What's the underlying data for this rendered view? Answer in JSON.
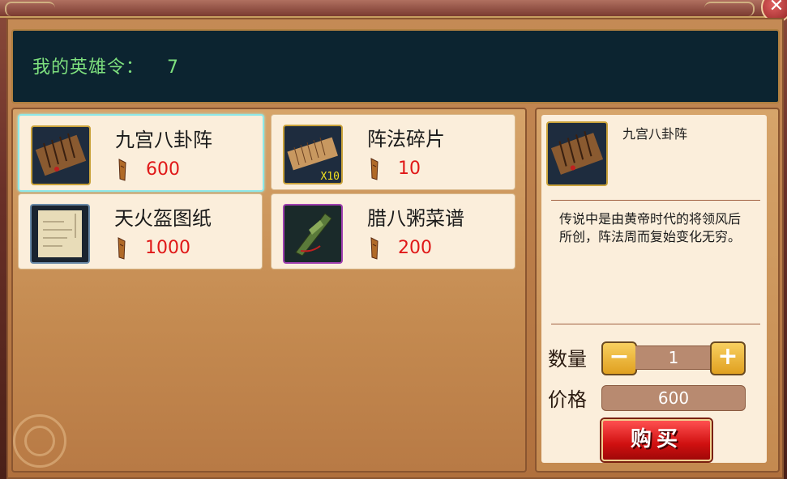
{
  "header": {
    "hero_token_label": "我的英雄令：",
    "hero_token_value": "7"
  },
  "items": [
    {
      "name": "九宫八卦阵",
      "price": "600",
      "qty_badge": ""
    },
    {
      "name": "阵法碎片",
      "price": "10",
      "qty_badge": "X10"
    },
    {
      "name": "天火盔图纸",
      "price": "1000",
      "qty_badge": ""
    },
    {
      "name": "腊八粥菜谱",
      "price": "200",
      "qty_badge": ""
    }
  ],
  "detail": {
    "name": "九宫八卦阵",
    "description": "传说中是由黄帝时代的将领风后所创，阵法周而复始变化无穷。",
    "quantity_label": "数量",
    "quantity_value": "1",
    "price_label": "价格",
    "price_value": "600",
    "buy_label": "购买",
    "minus_symbol": "−",
    "plus_symbol": "+"
  },
  "close_symbol": "✕",
  "colors": {
    "header_text": "#7ee07e",
    "price_text": "#e01818",
    "buy_button": "#d01010"
  }
}
